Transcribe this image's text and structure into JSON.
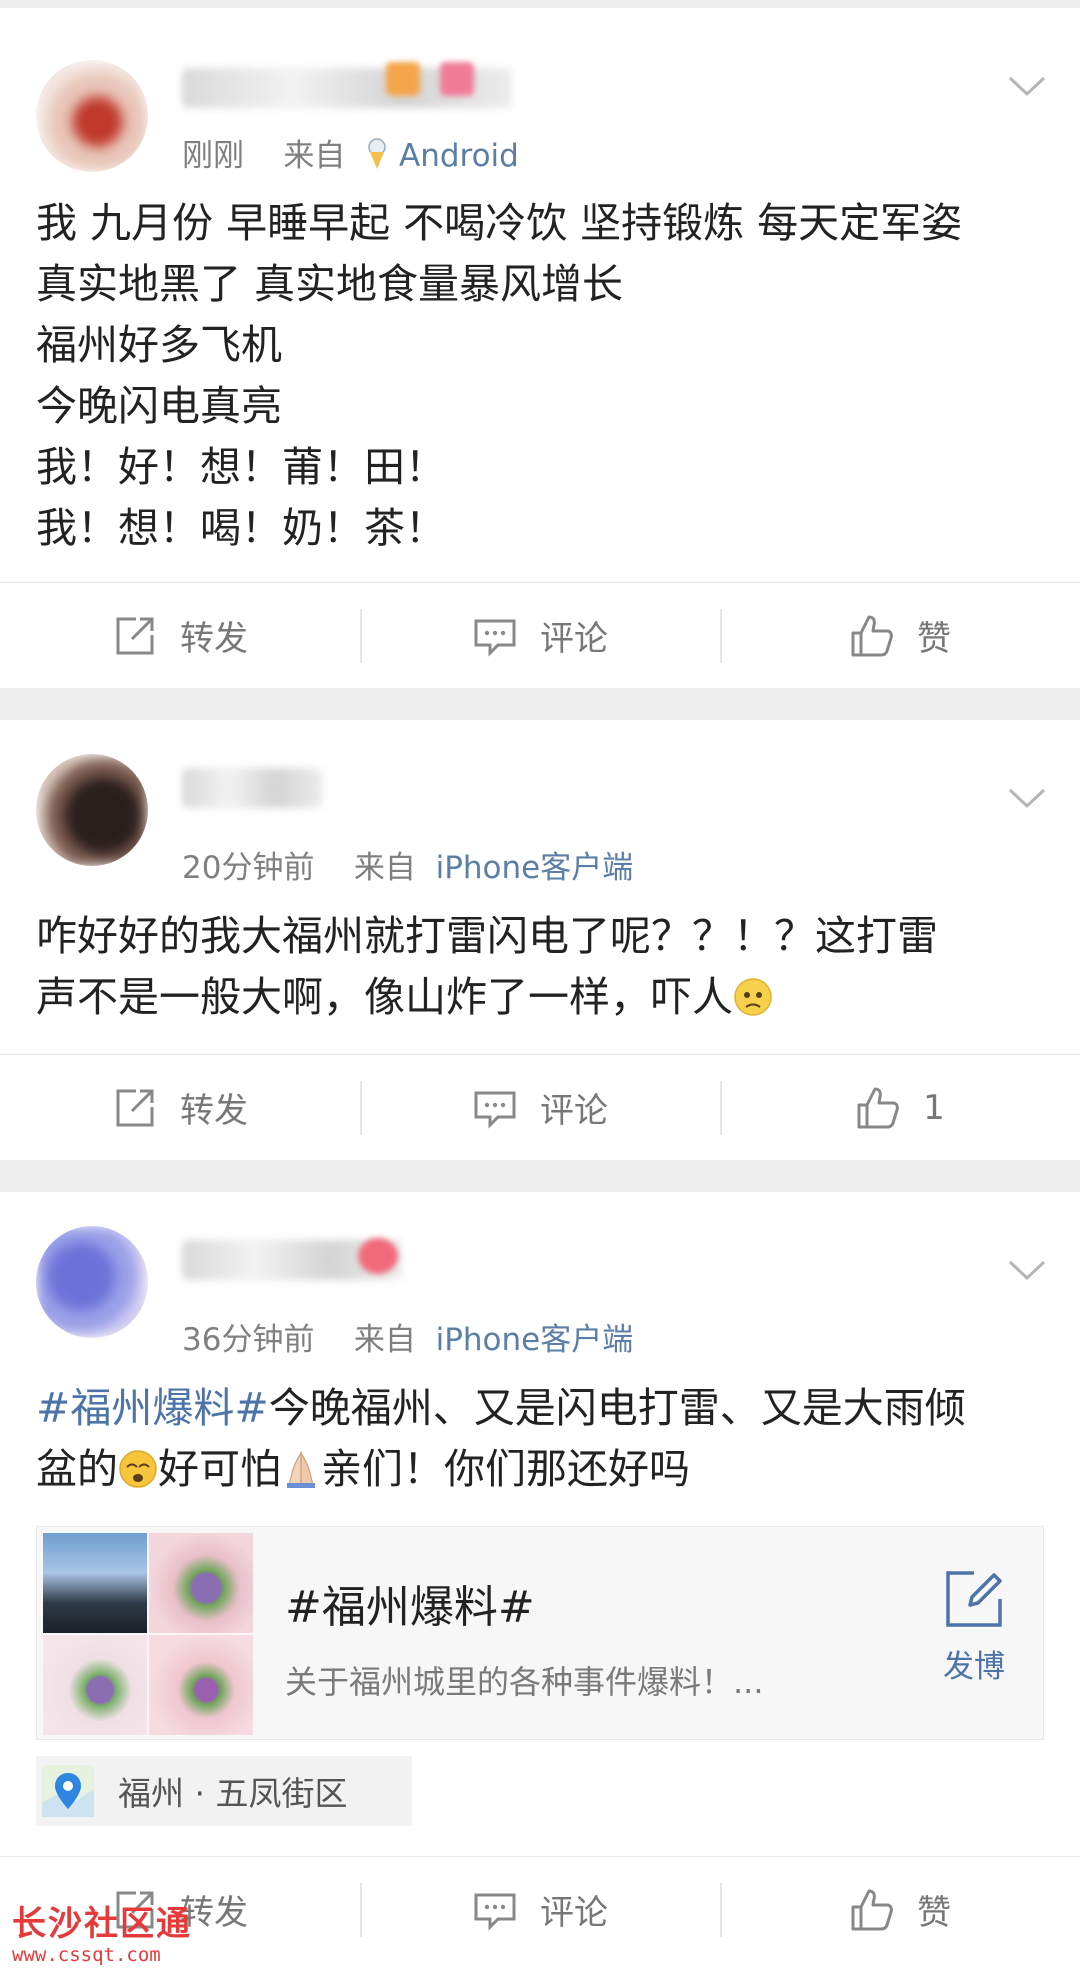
{
  "posts": [
    {
      "time": "刚刚",
      "source_prefix": "来自",
      "source": "Android",
      "lines": [
        "我 九月份 早睡早起 不喝冷饮 坚持锻炼 每天定军姿",
        "真实地黑了 真实地食量暴风增长",
        "福州好多飞机",
        "今晚闪电真亮",
        "我！好！想！莆！田！",
        "我！想！喝！奶！茶！"
      ],
      "actions": {
        "repost": "转发",
        "comment": "评论",
        "like": "赞"
      }
    },
    {
      "time": "20分钟前",
      "source_prefix": "来自",
      "source": "iPhone客户端",
      "lines": [
        "咋好好的我大福州就打雷闪电了呢？？！？这打雷",
        "声不是一般大啊，像山炸了一样，吓人"
      ],
      "actions": {
        "repost": "转发",
        "comment": "评论",
        "like": "1"
      }
    },
    {
      "time": "36分钟前",
      "source_prefix": "来自",
      "source": "iPhone客户端",
      "hashtag": "#福州爆料#",
      "line1_rest": "今晚福州、又是闪电打雷、又是大雨倾",
      "line2_a": "盆的",
      "line2_b": "好可怕",
      "line2_c": "亲们！你们那还好吗",
      "card": {
        "title": "#福州爆料#",
        "desc": "关于福州城里的各种事件爆料！...",
        "action": "发博"
      },
      "location": "福州 · 五凤街区",
      "actions": {
        "repost": "转发",
        "comment": "评论",
        "like": "赞"
      }
    }
  ],
  "watermark": {
    "title": "长沙社区通",
    "url": "www.cssqt.com"
  },
  "colors": {
    "link": "#4c74a8",
    "meta": "#808080",
    "watermark": "#e63a3a"
  },
  "icons": [
    "repost-icon",
    "comment-icon",
    "like-icon",
    "chevron-down-icon",
    "compose-icon",
    "location-pin-icon"
  ]
}
